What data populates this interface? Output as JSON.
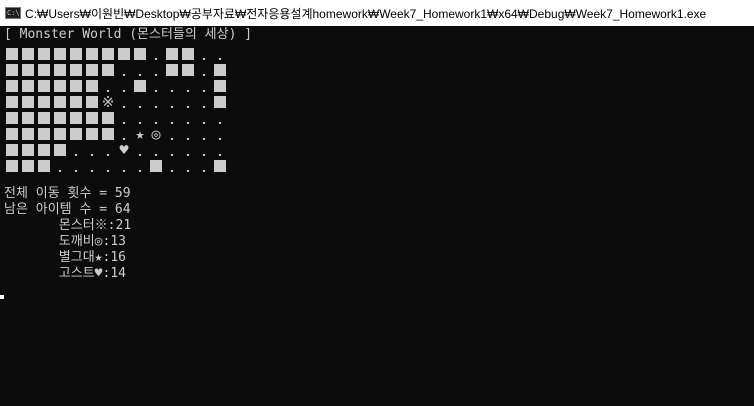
{
  "window": {
    "title": "C:₩Users₩이원빈₩Desktop₩공부자료₩전자응용설계homework₩Week7_Homework1₩x64₩Debug₩Week7_Homework1.exe",
    "icon": "console-app-icon",
    "icon_label": "C:\\"
  },
  "console": {
    "header": "[ Monster World (몬스터들의 세상) ]",
    "map_rows": [
      "#########.##..",
      "#######...##.#",
      "######..#....#",
      "######M......#",
      "#######.......",
      "#######.SG....",
      "####...H......",
      "###......#...#"
    ],
    "map_legend": {
      "#": "wall",
      ".": "empty",
      "M": "※",
      "G": "◎",
      "S": "★",
      "H": "♥"
    },
    "stats": {
      "total_moves": "전체 이동 횟수 = 59",
      "remaining_items": "남은 아이템 수 = 64",
      "monster": "       몬스터※:21",
      "goblin": "       도깨비◎:13",
      "star": "       별그대★:16",
      "ghost": "       고스트♥:14"
    }
  },
  "colors": {
    "background": "#0c0c0c",
    "text": "#cccccc",
    "titlebar": "#ffffff"
  }
}
